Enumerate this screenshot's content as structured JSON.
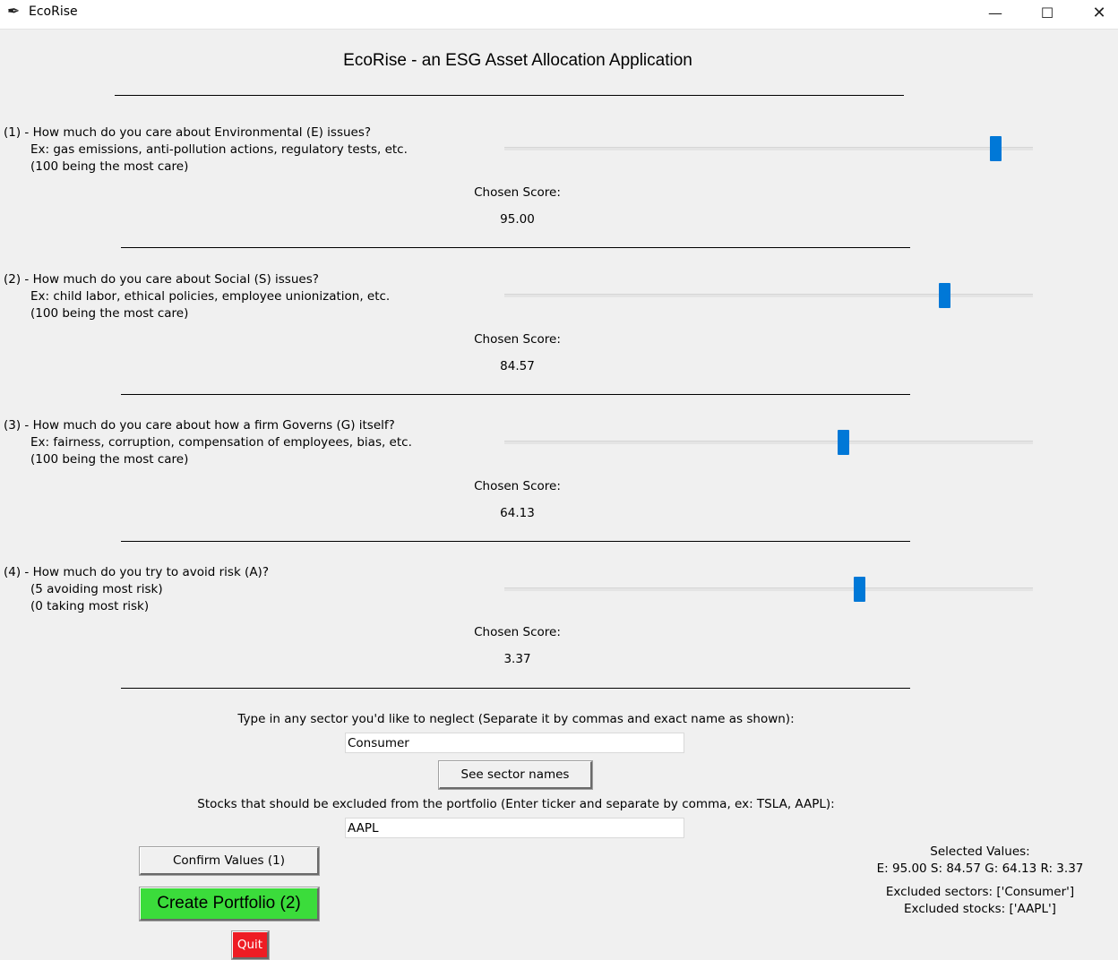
{
  "window": {
    "title": "EcoRise",
    "app_icon": "feather-icon",
    "controls": {
      "minimize": "—",
      "maximize": "☐",
      "close": "✕"
    }
  },
  "heading": "EcoRise - an ESG Asset Allocation Application",
  "chosen_label": "Chosen Score:",
  "questions": [
    {
      "lines": [
        "(1) - How much do you care about Environmental (E) issues?",
        "Ex: gas emissions, anti-pollution actions, regulatory tests, etc.",
        "(100 being the most care)"
      ],
      "score_text": "95.00",
      "slider": {
        "value": 95.0,
        "min": 0,
        "max": 100
      }
    },
    {
      "lines": [
        "(2) - How much do you care about Social (S) issues?",
        "Ex: child labor, ethical policies, employee unionization, etc.",
        "(100 being the most care)"
      ],
      "score_text": "84.57",
      "slider": {
        "value": 84.57,
        "min": 0,
        "max": 100
      }
    },
    {
      "lines": [
        "(3) - How much do you care about how a firm Governs (G) itself?",
        "Ex: fairness, corruption, compensation of employees, bias, etc.",
        "(100 being the most care)"
      ],
      "score_text": "64.13",
      "slider": {
        "value": 64.13,
        "min": 0,
        "max": 100
      }
    },
    {
      "lines": [
        "(4) - How much do you try to avoid risk (A)?",
        "(5 avoiding most risk)",
        "(0 taking most risk)"
      ],
      "score_text": "3.37",
      "slider": {
        "value": 3.37,
        "min": 0,
        "max": 5
      }
    }
  ],
  "sector": {
    "prompt": "Type in any sector you'd like to neglect (Separate it by commas and exact name as shown):",
    "value": "Consumer",
    "button": "See sector names"
  },
  "stocks": {
    "prompt": "Stocks that should be excluded from the portfolio (Enter ticker and separate by comma, ex: TSLA, AAPL):",
    "value": "AAPL"
  },
  "buttons": {
    "confirm": "Confirm Values (1)",
    "create": "Create Portfolio (2)",
    "quit": "Quit"
  },
  "colors": {
    "slider_thumb": "#0078d7",
    "create_button": "#3bdc3b",
    "quit_button": "#ee1c24"
  },
  "summary": {
    "title": "Selected Values:",
    "values": "E: 95.00 S: 84.57 G: 64.13 R: 3.37",
    "sectors": "Excluded sectors: ['Consumer']",
    "stocks": "Excluded stocks: ['AAPL']"
  }
}
